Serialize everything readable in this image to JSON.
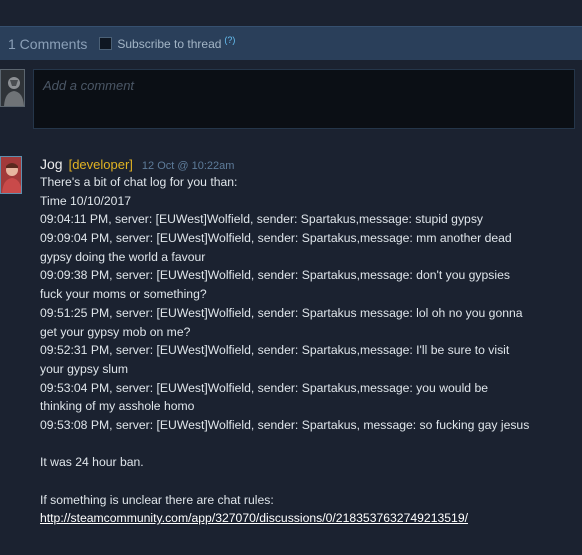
{
  "header": {
    "comment_count": "1 Comments",
    "subscribe_label": "Subscribe to thread",
    "help_label": "(?)"
  },
  "composer": {
    "placeholder": "Add a comment"
  },
  "comment": {
    "author": "Jog",
    "badge": "[developer]",
    "date": "12 Oct @ 10:22am",
    "lines": [
      "There's a bit of chat log for you than:",
      "Time 10/10/2017",
      "09:04:11 PM, server: [EUWest]Wolfield, sender: Spartakus,message: stupid gypsy",
      "09:09:04 PM, server: [EUWest]Wolfield, sender: Spartakus,message: mm another dead",
      "gypsy doing the world a favour",
      "09:09:38 PM, server: [EUWest]Wolfield, sender: Spartakus,message: don't you gypsies",
      "fuck your moms or something?",
      "09:51:25 PM, server: [EUWest]Wolfield, sender: Spartakus message: lol oh no you gonna",
      "get your gypsy mob on me?",
      "09:52:31 PM, server: [EUWest]Wolfield, sender: Spartakus,message: I'll be sure to visit",
      "your gypsy slum",
      "09:53:04 PM, server: [EUWest]Wolfield, sender: Spartakus,message: you would be",
      "thinking of my asshole homo",
      "09:53:08 PM, server: [EUWest]Wolfield, sender: Spartakus, message: so fucking gay jesus",
      "",
      "It was 24 hour ban.",
      "",
      "If something is unclear there are chat rules:"
    ],
    "link_text": "http://steamcommunity.com/app/327070/discussions/0/2183537632749213519/"
  },
  "colors": {
    "header_bg": "#2a3f5a",
    "page_bg": "#1b2230",
    "badge": "#e1b323",
    "date": "#5e7c9a",
    "link": "#ffffff"
  }
}
